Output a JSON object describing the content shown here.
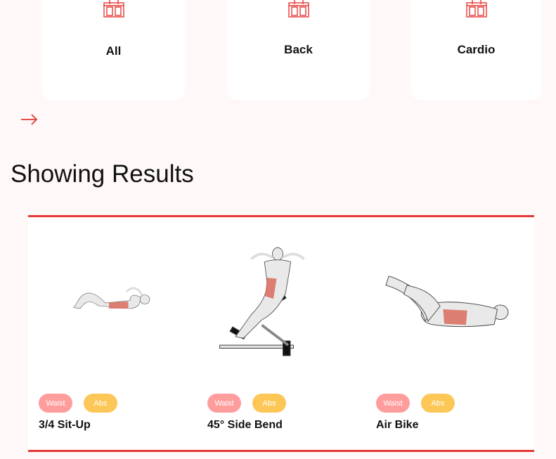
{
  "categories": [
    {
      "label": "All",
      "icon": "gym-icon"
    },
    {
      "label": "Back",
      "icon": "gym-icon"
    },
    {
      "label": "Cardio",
      "icon": "gym-icon"
    }
  ],
  "nav": {
    "next_icon": "arrow-right-icon"
  },
  "heading": "Showing Results",
  "exercises": [
    {
      "name": "3/4 Sit-Up",
      "tags": [
        "Waist",
        "Abs"
      ]
    },
    {
      "name": "45° Side Bend",
      "tags": [
        "Waist",
        "Abs"
      ]
    },
    {
      "name": "Air Bike",
      "tags": [
        "Waist",
        "Abs"
      ]
    }
  ],
  "colors": {
    "accent": "#e53935",
    "waist": "#ff9d9d",
    "abs": "#fcc757",
    "background": "#fff8f8"
  }
}
